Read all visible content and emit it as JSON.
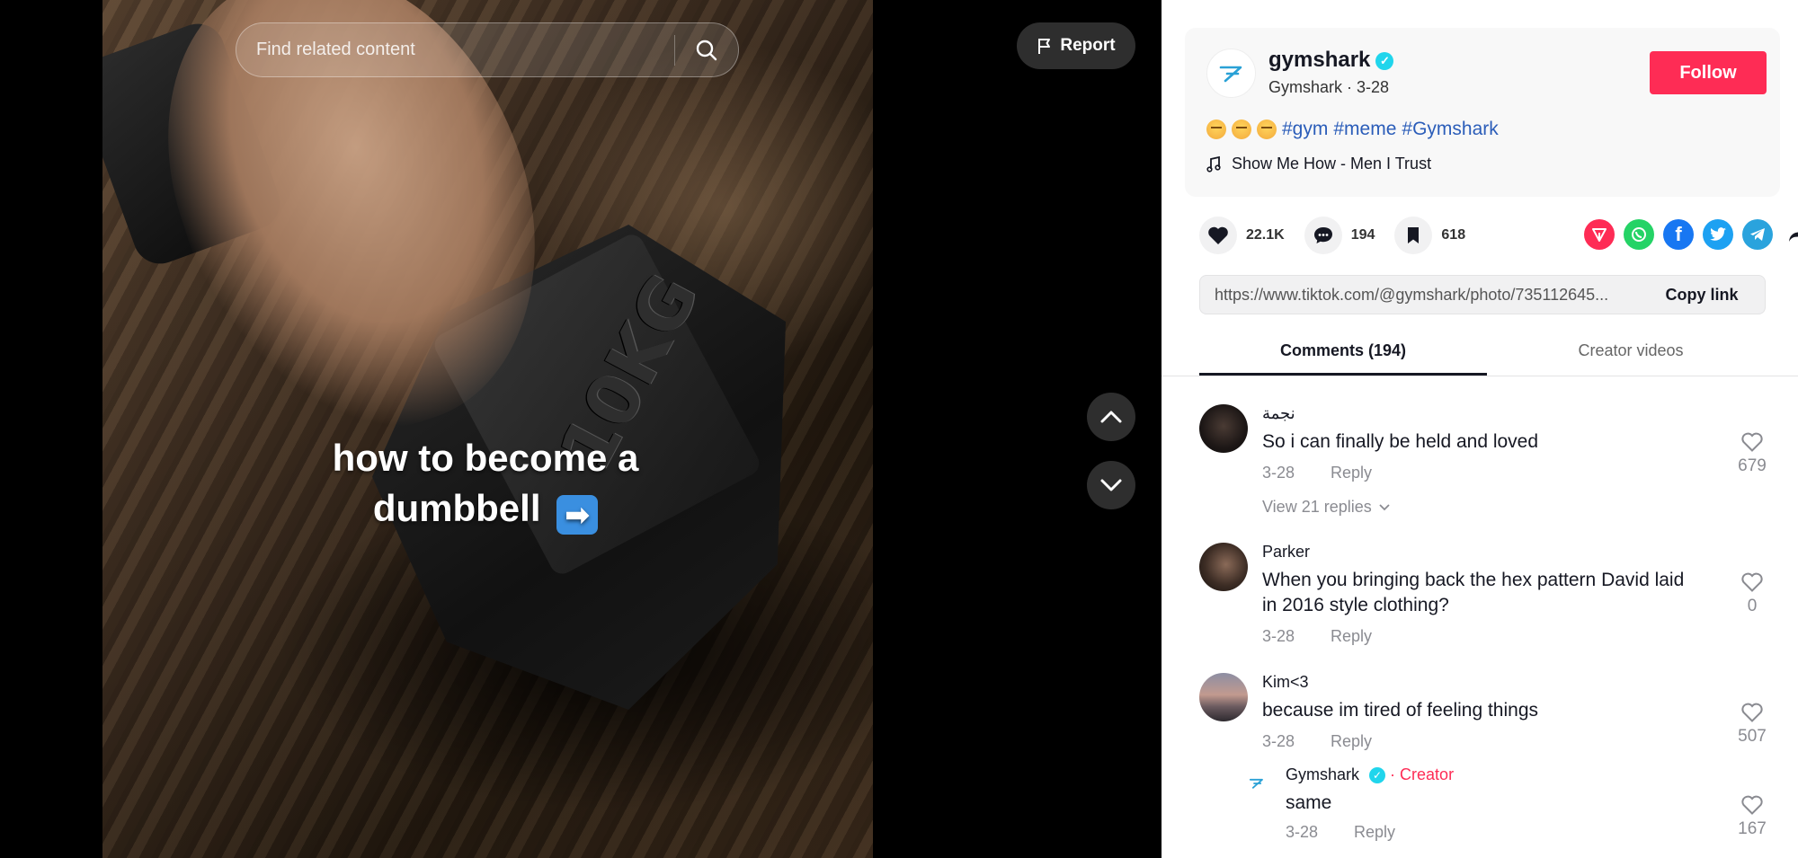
{
  "search": {
    "placeholder": "Find related content"
  },
  "report_label": "Report",
  "caption": {
    "line1": "how to become a",
    "line2": "dumbbell",
    "arrow": "➡"
  },
  "photo_text": "10KG",
  "author": {
    "name": "gymshark",
    "subtitle": "Gymshark · 3-28",
    "follow_label": "Follow"
  },
  "post": {
    "tags": [
      "#gym",
      "#meme",
      "#Gymshark"
    ],
    "music": "Show Me How - Men I Trust"
  },
  "actions": {
    "likes": "22.1K",
    "comments": "194",
    "saves": "618"
  },
  "share_icons": [
    "repost-icon",
    "whatsapp-icon",
    "facebook-icon",
    "twitter-icon",
    "telegram-icon",
    "share-arrow-icon"
  ],
  "colors": {
    "accent": "#fe2c55",
    "verified": "#20d5ec",
    "hashtag": "#2b5db9"
  },
  "link": {
    "url": "https://www.tiktok.com/@gymshark/photo/735112645...",
    "copy_label": "Copy link"
  },
  "tabs": [
    {
      "label": "Comments (194)",
      "active": true
    },
    {
      "label": "Creator videos",
      "active": false
    }
  ],
  "comments": [
    {
      "user": "نجمة",
      "text": "So i can finally be held and loved",
      "date": "3-28",
      "reply": "Reply",
      "likes": "679",
      "view_replies": "View 21 replies"
    },
    {
      "user": "Parker",
      "text": "When you bringing back the hex pattern David laid in 2016 style clothing?",
      "date": "3-28",
      "reply": "Reply",
      "likes": "0"
    },
    {
      "user": "Kim<3",
      "text": "because im tired of feeling things",
      "date": "3-28",
      "reply": "Reply",
      "likes": "507"
    }
  ],
  "creator_reply": {
    "user": "Gymshark",
    "creator_label": "· Creator",
    "text": "same",
    "date": "3-28",
    "reply": "Reply",
    "likes": "167"
  }
}
